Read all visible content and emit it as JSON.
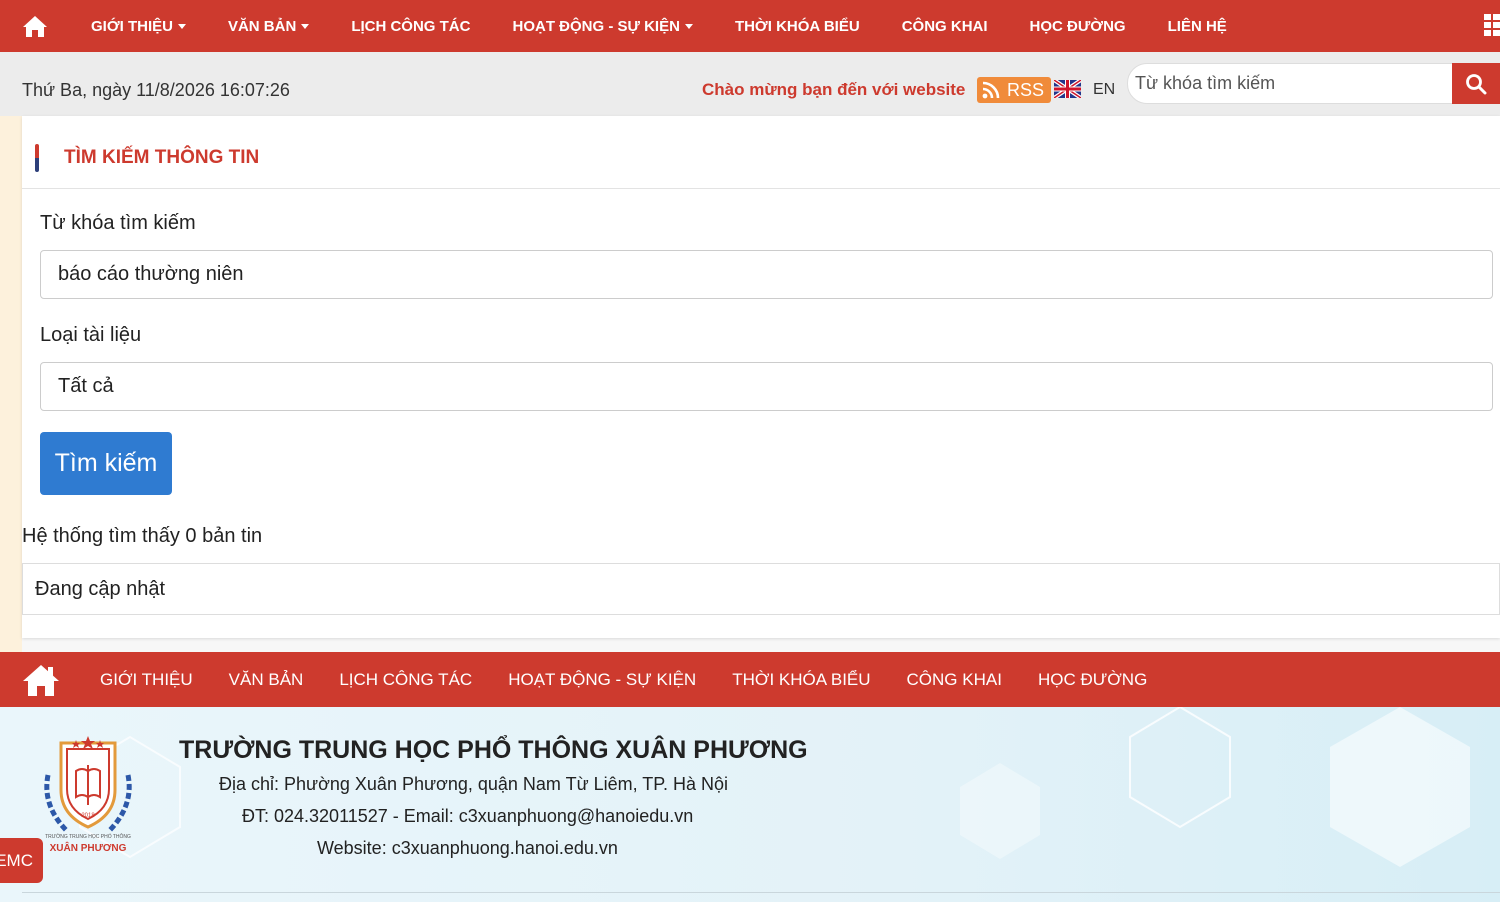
{
  "top_nav": {
    "items": [
      {
        "label": "GIỚI THIỆU",
        "has_dropdown": true
      },
      {
        "label": "VĂN BẢN",
        "has_dropdown": true
      },
      {
        "label": "LỊCH CÔNG TÁC",
        "has_dropdown": false
      },
      {
        "label": "HOẠT ĐỘNG - SỰ KIỆN",
        "has_dropdown": true
      },
      {
        "label": "THỜI KHÓA BIỂU",
        "has_dropdown": false
      },
      {
        "label": "CÔNG KHAI",
        "has_dropdown": false
      },
      {
        "label": "HỌC ĐƯỜNG",
        "has_dropdown": false
      },
      {
        "label": "LIÊN HỆ",
        "has_dropdown": false
      }
    ]
  },
  "info_bar": {
    "datetime": "Thứ Ba, ngày 11/8/2026 16:07:26",
    "welcome": "Chào mừng bạn đến với website",
    "rss_label": "RSS",
    "lang_label": "EN",
    "search_placeholder": "Từ khóa tìm kiếm"
  },
  "search_page": {
    "title": "TÌM KIẾM THÔNG TIN",
    "keyword_label": "Từ khóa tìm kiếm",
    "keyword_value": "báo cáo thường niên",
    "type_label": "Loại tài liệu",
    "type_value": "Tất cả",
    "search_button": "Tìm kiếm",
    "result_text": "Hệ thống tìm thấy 0 bản tin",
    "result_status": "Đang cập nhật"
  },
  "bottom_nav": {
    "items": [
      "GIỚI THIỆU",
      "VĂN BẢN",
      "LỊCH CÔNG TÁC",
      "HOẠT ĐỘNG - SỰ KIỆN",
      "THỜI KHÓA BIỂU",
      "CÔNG KHAI",
      "HỌC ĐƯỜNG"
    ]
  },
  "footer": {
    "school_name": "TRƯỜNG TRUNG HỌC PHỔ THÔNG XUÂN PHƯƠNG",
    "address": "Địa chỉ: Phường Xuân Phương, quận Nam Từ Liêm, TP. Hà Nội",
    "contact": "ĐT: 024.32011527 - Email: c3xuanphuong@hanoiedu.vn",
    "website": "Website: c3xuanphuong.hanoi.edu.vn",
    "logo_small_text": "TRƯỜNG TRUNG HỌC PHỔ THÔNG",
    "logo_year": "2018",
    "logo_name": "XUÂN PHƯƠNG"
  },
  "emc_label": "EMC",
  "colors": {
    "brand_red": "#cd3a2e",
    "button_blue": "#2f7bd1",
    "rss_orange": "#f08b3a"
  },
  "icons": [
    "home-icon",
    "caret-down-icon",
    "grid-menu-icon",
    "rss-icon",
    "uk-flag-icon",
    "search-icon"
  ]
}
